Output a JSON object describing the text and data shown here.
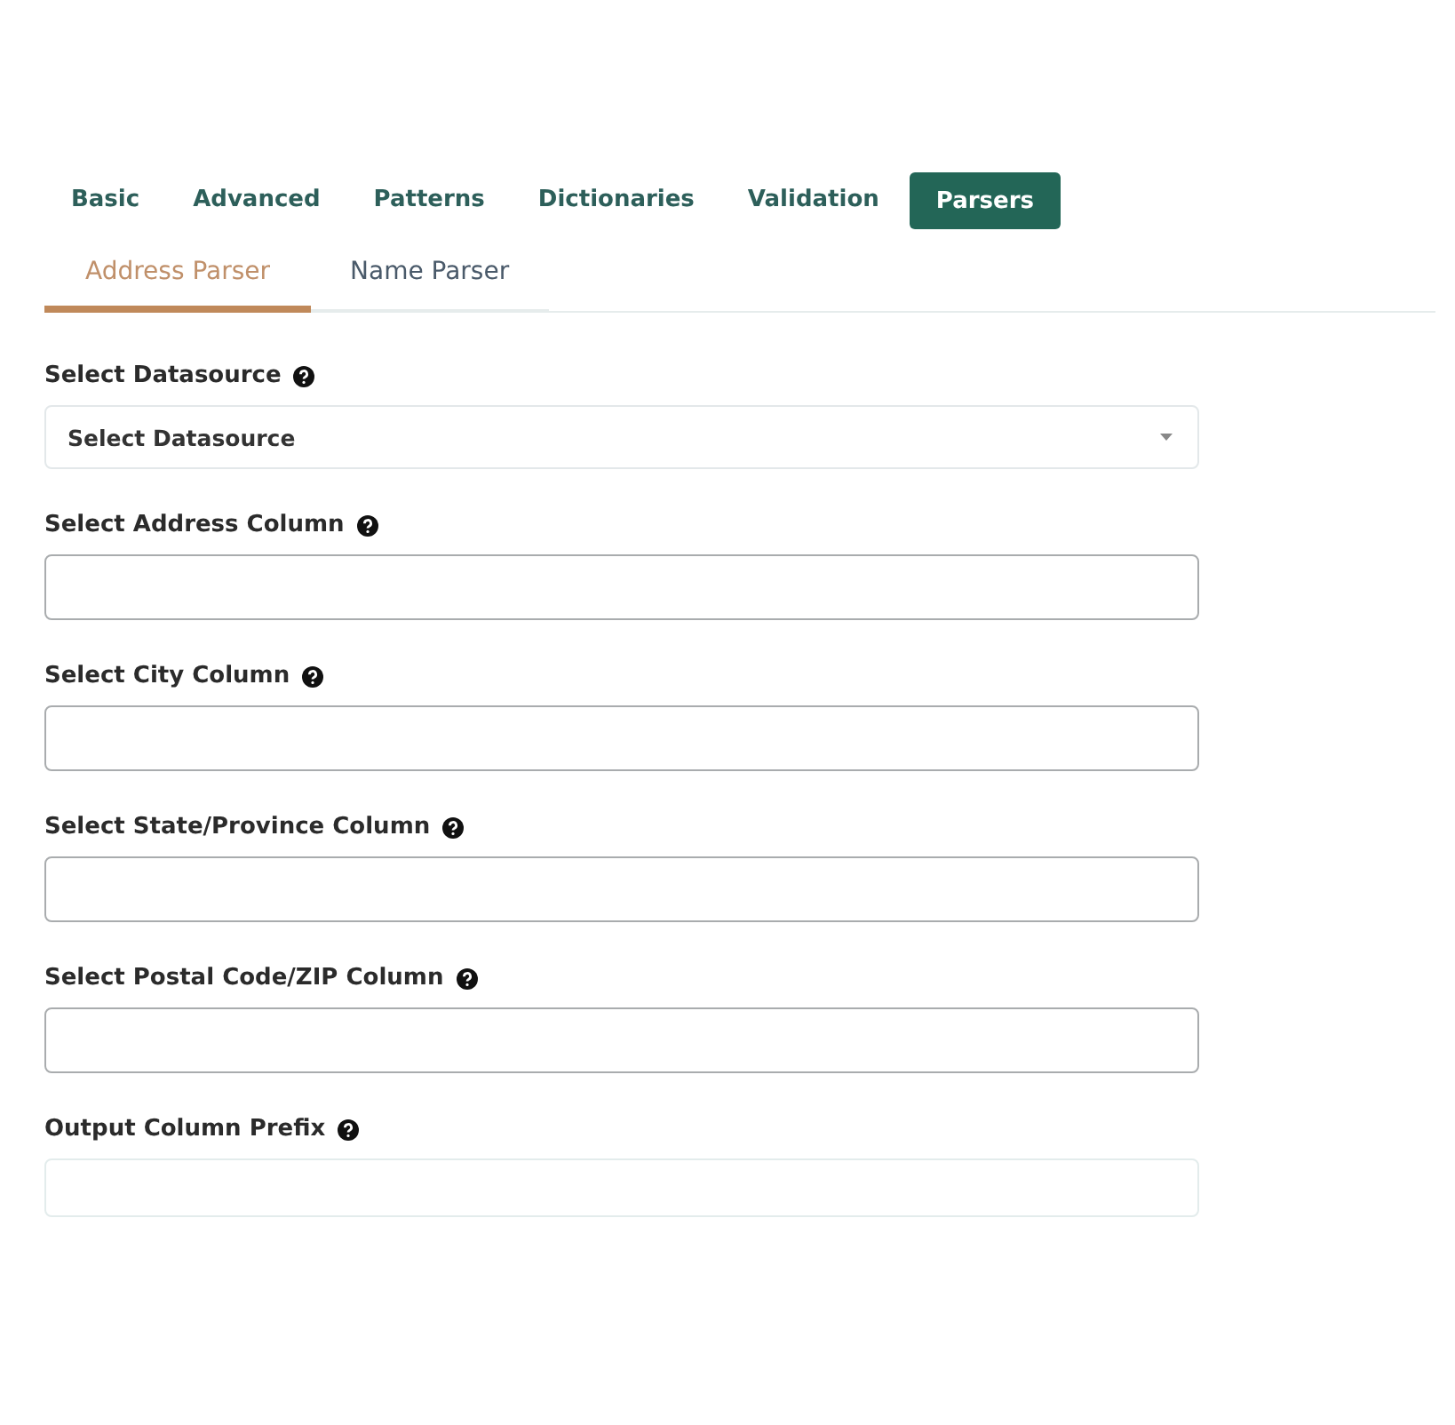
{
  "tabs": [
    {
      "label": "Basic",
      "selected": false
    },
    {
      "label": "Advanced",
      "selected": false
    },
    {
      "label": "Patterns",
      "selected": false
    },
    {
      "label": "Dictionaries",
      "selected": false
    },
    {
      "label": "Validation",
      "selected": false
    },
    {
      "label": "Parsers",
      "selected": true
    }
  ],
  "subtabs": [
    {
      "label": "Address Parser",
      "selected": true
    },
    {
      "label": "Name Parser",
      "selected": false
    }
  ],
  "fields": [
    {
      "label": "Select Datasource",
      "kind": "select",
      "value": "Select Datasource"
    },
    {
      "label": "Select Address Column",
      "kind": "combo"
    },
    {
      "label": "Select City Column",
      "kind": "combo"
    },
    {
      "label": "Select State/Province Column",
      "kind": "combo"
    },
    {
      "label": "Select Postal Code/ZIP Column",
      "kind": "combo"
    },
    {
      "label": "Output Column Prefix",
      "kind": "text"
    }
  ]
}
